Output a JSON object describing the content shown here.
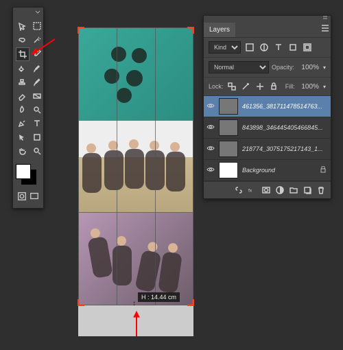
{
  "toolbox": {
    "tools": [
      {
        "name": "move-tool"
      },
      {
        "name": "marquee-tool"
      },
      {
        "name": "lasso-tool"
      },
      {
        "name": "wand-tool"
      },
      {
        "name": "crop-tool",
        "active": true
      },
      {
        "name": "eyedropper-tool"
      },
      {
        "name": "healing-tool"
      },
      {
        "name": "brush-tool"
      },
      {
        "name": "stamp-tool"
      },
      {
        "name": "history-brush-tool"
      },
      {
        "name": "eraser-tool"
      },
      {
        "name": "gradient-tool"
      },
      {
        "name": "blur-tool"
      },
      {
        "name": "dodge-tool"
      },
      {
        "name": "pen-tool"
      },
      {
        "name": "type-tool"
      },
      {
        "name": "path-select-tool"
      },
      {
        "name": "shape-tool"
      },
      {
        "name": "hand-tool"
      },
      {
        "name": "zoom-tool"
      }
    ],
    "fg_color": "#ffffff",
    "bg_color": "#000000"
  },
  "canvas": {
    "dimension_label": "H :   14.44 cm"
  },
  "layers_panel": {
    "title": "Layers",
    "filter_mode": "Kind",
    "blend_mode": "Normal",
    "opacity_label": "Opacity:",
    "opacity_value": "100%",
    "lock_label": "Lock:",
    "fill_label": "Fill:",
    "fill_value": "100%",
    "layers": [
      {
        "name": "461356_381711478514763...",
        "selected": true
      },
      {
        "name": "843898_346445405466845..."
      },
      {
        "name": "218774_307517521714­3_1..."
      },
      {
        "name": "Background",
        "locked": true,
        "bg": true
      }
    ]
  }
}
